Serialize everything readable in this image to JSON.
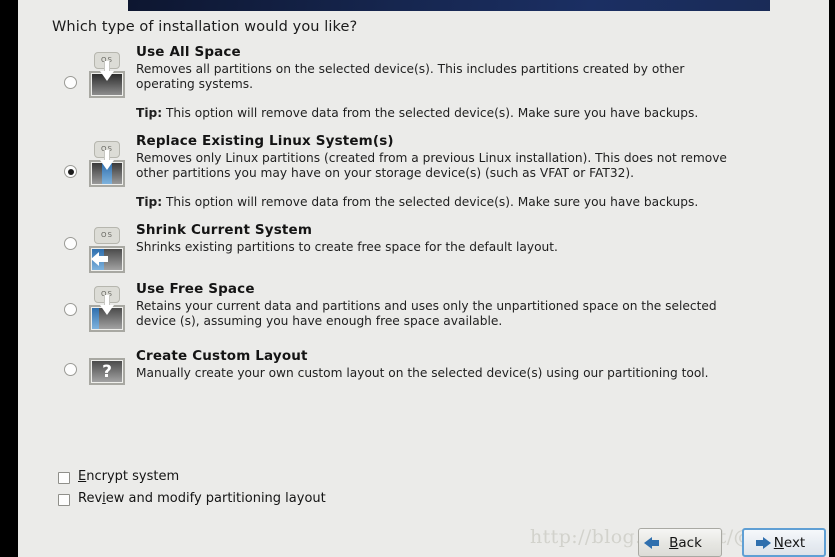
{
  "window": {
    "question": "Which type of installation would you like?",
    "banner_color": "#16264f",
    "panel_bg": "#ebebe9"
  },
  "options": [
    {
      "id": "use-all-space",
      "title": "Use All Space",
      "desc": "Removes all partitions on the selected device(s).  This includes partitions created by other operating systems.",
      "tip_label": "Tip:",
      "tip": "This option will remove data from the selected device(s).  Make sure you have backups.",
      "selected": false,
      "icon": "disk-erase-icon",
      "os_tag": "OS"
    },
    {
      "id": "replace-existing-linux",
      "title": "Replace Existing Linux System(s)",
      "desc": "Removes only Linux partitions (created from a previous Linux installation).  This does not remove other partitions you may have on your storage device(s) (such as VFAT or FAT32).",
      "tip_label": "Tip:",
      "tip": "This option will remove data from the selected device(s).  Make sure you have backups.",
      "selected": true,
      "icon": "disk-replace-icon",
      "os_tag": "OS"
    },
    {
      "id": "shrink-current-system",
      "title": "Shrink Current System",
      "desc": "Shrinks existing partitions to create free space for the default layout.",
      "tip_label": "",
      "tip": "",
      "selected": false,
      "icon": "disk-shrink-icon",
      "os_tag": "OS"
    },
    {
      "id": "use-free-space",
      "title": "Use Free Space",
      "desc": "Retains your current data and partitions and uses only the unpartitioned space on the selected device (s), assuming you have enough free space available.",
      "tip_label": "",
      "tip": "",
      "selected": false,
      "icon": "disk-free-space-icon",
      "os_tag": "OS"
    },
    {
      "id": "create-custom-layout",
      "title": "Create Custom Layout",
      "desc": "Manually create your own custom layout on the selected device(s) using our partitioning tool.",
      "tip_label": "",
      "tip": "",
      "selected": false,
      "icon": "disk-custom-icon",
      "os_tag": "?"
    }
  ],
  "checkboxes": [
    {
      "id": "encrypt-system",
      "label": "Encrypt system",
      "mnemonic": "E",
      "checked": false
    },
    {
      "id": "review-modify",
      "label": "Review and modify partitioning layout",
      "mnemonic": "i",
      "checked": false
    }
  ],
  "buttons": {
    "back": {
      "label": "Back",
      "mnemonic": "B"
    },
    "next": {
      "label": "Next",
      "mnemonic": "N",
      "focused": true
    }
  },
  "watermark": "http://blog.csdn.net/@5to10"
}
